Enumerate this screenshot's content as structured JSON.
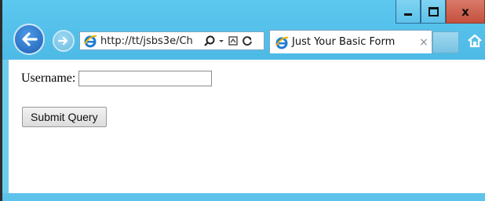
{
  "browser": {
    "address_url": "http://tt/jsbs3e/Ch",
    "tab_title": "Just Your Basic Form",
    "tab_close": "×"
  },
  "window_controls": {
    "close_glyph": "x"
  },
  "form": {
    "username_label": "Username:",
    "username_value": "",
    "submit_label": "Submit Query"
  },
  "icons": [
    "back-arrow-icon",
    "forward-arrow-icon",
    "ie-logo-icon",
    "search-icon",
    "dropdown-icon",
    "compatibility-icon",
    "refresh-icon",
    "home-icon"
  ],
  "colors": {
    "chrome": "#5cc8ef",
    "close_button": "#c4503d",
    "back_button": "#1f5fb7"
  }
}
